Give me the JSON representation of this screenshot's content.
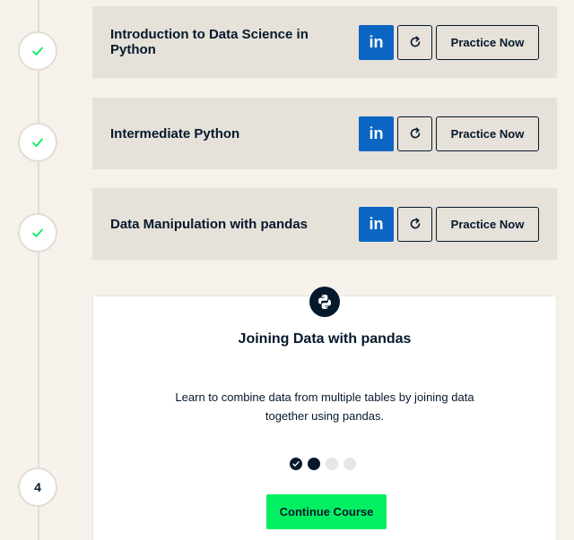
{
  "track": {
    "completed_courses": [
      {
        "title": "Introduction to Data Science in Python",
        "linkedin_label": "in",
        "practice_label": "Practice Now"
      },
      {
        "title": "Intermediate Python",
        "linkedin_label": "in",
        "practice_label": "Practice Now"
      },
      {
        "title": "Data Manipulation with pandas",
        "linkedin_label": "in",
        "practice_label": "Practice Now"
      }
    ],
    "current_course": {
      "step_number": "4",
      "technology_icon": "python-icon",
      "title": "Joining Data with pandas",
      "description": "Learn to combine data from multiple tables by joining data together using pandas.",
      "progress": {
        "completed_chapters": 1,
        "current_chapter": 2,
        "total_chapters": 4
      },
      "continue_label": "Continue Course"
    }
  },
  "colors": {
    "background": "#f6f1ea",
    "card_completed": "#e6e1d9",
    "navy": "#05192d",
    "linkedin_blue": "#0a66c2",
    "check_green": "#03ef62",
    "continue_green": "#03ef62"
  }
}
